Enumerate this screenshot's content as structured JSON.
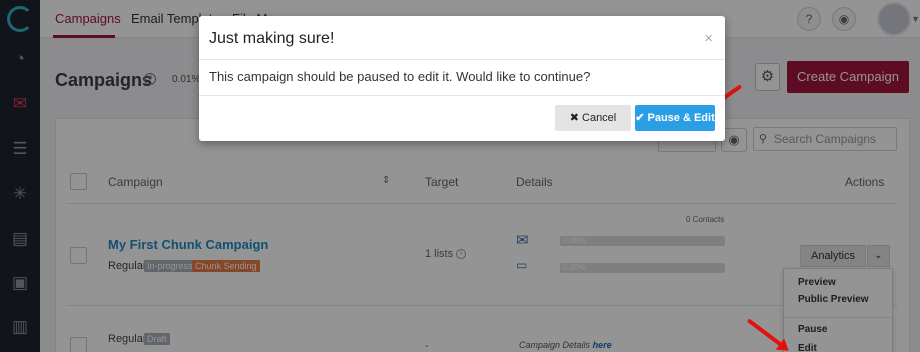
{
  "colors": {
    "brand": "#a2163f",
    "link": "#1f8bc7",
    "primary": "#2a9fe6",
    "danger_arrow": "#e0120f"
  },
  "rail": {
    "icons": [
      "logo-icon",
      "speedometer-icon",
      "envelope-icon",
      "hierarchy-icon",
      "network-icon",
      "document-chart-icon",
      "report-icon",
      "clipboard-icon"
    ]
  },
  "topnav": {
    "tabs": [
      {
        "label": "Campaigns"
      },
      {
        "label": "Email Templates"
      },
      {
        "label": "File Manager"
      }
    ],
    "help": "?",
    "bell": "🔔"
  },
  "header": {
    "title": "Campaigns",
    "stat": "0.01%",
    "create_label": "Create Campaign"
  },
  "search": {
    "placeholder": "Search Campaigns"
  },
  "table": {
    "columns": {
      "campaign": "Campaign",
      "target": "Target",
      "details": "Details",
      "actions": "Actions"
    },
    "rows": [
      {
        "name": "My First Chunk Campaign",
        "type": "Regular",
        "badges": [
          "In-progress",
          "Chunk Sending"
        ],
        "target": "1 lists",
        "contacts": "0 Contacts",
        "stat1": "0.00%",
        "stat2": "0.00%",
        "action": "Analytics"
      },
      {
        "type": "Regular",
        "badge": "Draft",
        "target": "-",
        "details_text": "Campaign Details",
        "details_link": "here"
      }
    ]
  },
  "menu": {
    "items": [
      {
        "label": "Preview"
      },
      {
        "label": "Public Preview"
      },
      {
        "label": "Pause"
      },
      {
        "label": "Edit"
      }
    ]
  },
  "modal": {
    "title": "Just making sure!",
    "close": "×",
    "body": "This campaign should be paused to edit it. Would like to continue?",
    "cancel": "✖ Cancel",
    "confirm": "✔ Pause & Edit"
  }
}
